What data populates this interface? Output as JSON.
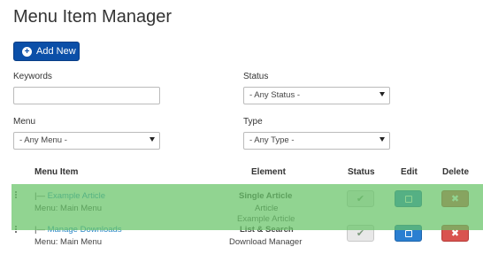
{
  "page": {
    "title": "Menu Item Manager"
  },
  "toolbar": {
    "add_label": "Add New",
    "add_icon": "plus-circle-icon"
  },
  "filters": {
    "keywords_label": "Keywords",
    "keywords_value": "",
    "status_label": "Status",
    "status_value": "- Any Status -",
    "menu_label": "Menu",
    "menu_value": "- Any Menu -",
    "type_label": "Type",
    "type_value": "- Any Type -"
  },
  "table": {
    "headers": {
      "item": "Menu Item",
      "element": "Element",
      "status": "Status",
      "edit": "Edit",
      "delete": "Delete"
    },
    "rows": [
      {
        "prefix": "|—",
        "title": "Example Article",
        "menu": "Menu: Main Menu",
        "element_title": "Single Article",
        "element_type": "Article"
      },
      {
        "prefix": "|—",
        "title": "Manage Downloads",
        "menu": "Menu: Main Menu",
        "element_title": "List & Search",
        "element_type": "Download Manager"
      }
    ],
    "status_icon": "✔",
    "delete_icon": "✖"
  },
  "drag_ghost": {
    "element_type": "Article",
    "element_title": "Example Article"
  },
  "colors": {
    "accent": "#0b4fa8",
    "link": "#2a87c6",
    "drag_highlight": "#66c466",
    "edit": "#2a7fd1",
    "delete": "#d9534f"
  }
}
